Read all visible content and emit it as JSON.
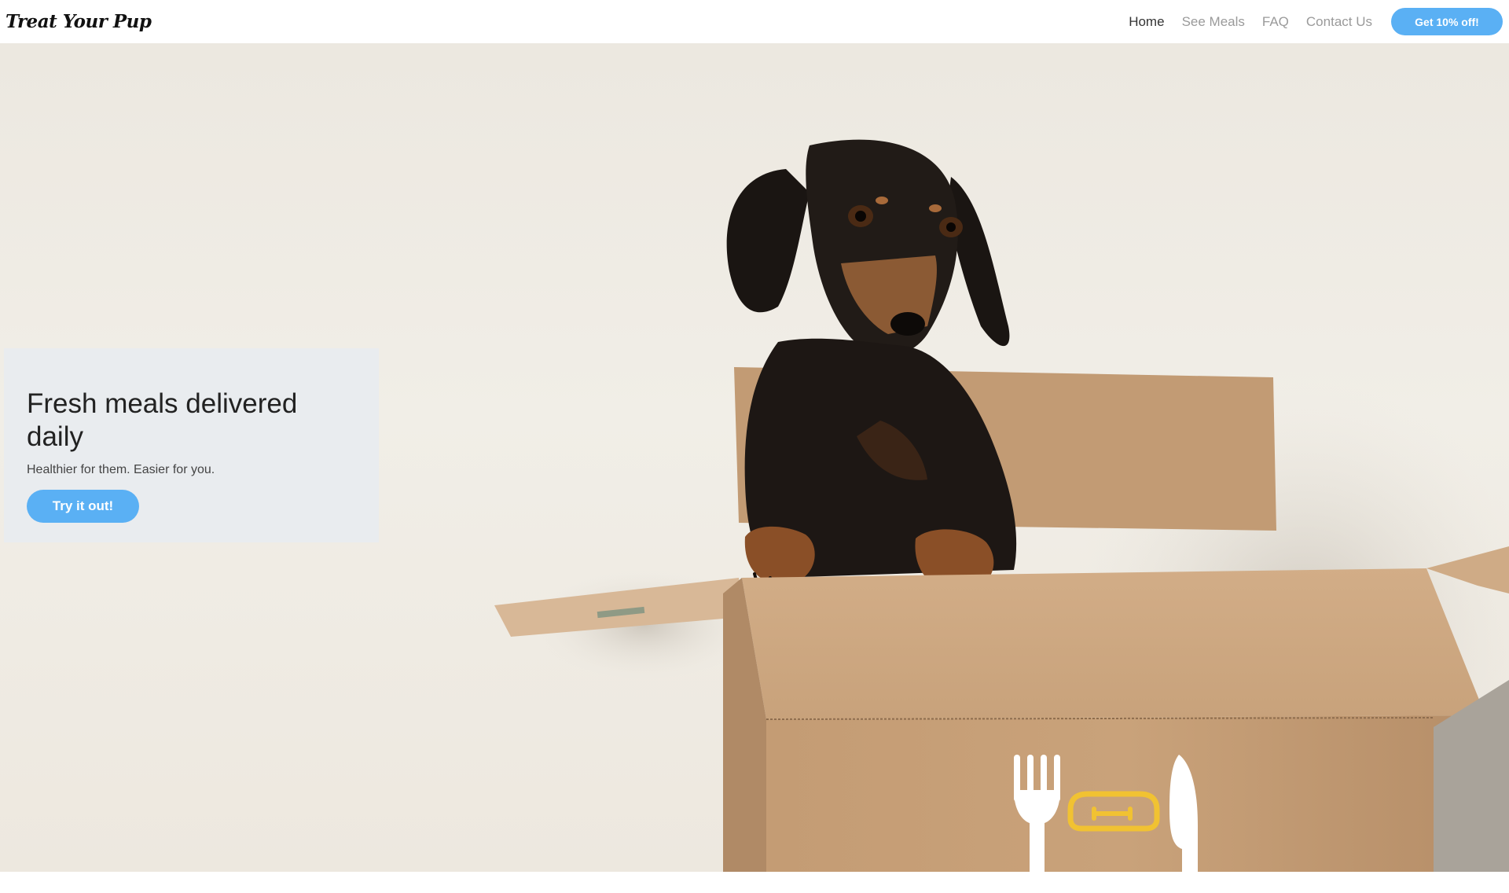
{
  "brand": {
    "name": "Treat Your Pup"
  },
  "nav": {
    "links": [
      {
        "label": "Home",
        "active": true
      },
      {
        "label": "See Meals",
        "active": false
      },
      {
        "label": "FAQ",
        "active": false
      },
      {
        "label": "Contact Us",
        "active": false
      }
    ],
    "cta_label": "Get 10% off!"
  },
  "hero": {
    "title": "Fresh meals delivered daily",
    "subtitle": "Healthier for them. Easier for you.",
    "button_label": "Try it out!",
    "image": "dachshund-in-cardboard-box",
    "box_icons": [
      "fork-icon",
      "dog-bowl-icon",
      "knife-icon"
    ]
  },
  "colors": {
    "accent": "#5ab0f4",
    "card_bg": "#e9ecef",
    "box_icon_accent": "#f1c232",
    "nav_muted": "#9a9a9a"
  }
}
